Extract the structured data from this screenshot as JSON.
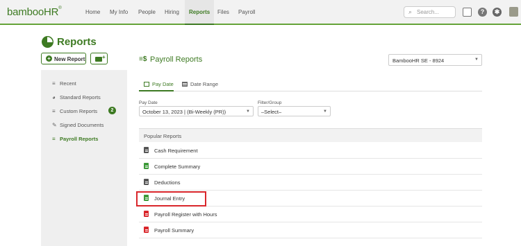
{
  "topnav": {
    "logo": "bambooHR",
    "items": [
      "Home",
      "My Info",
      "People",
      "Hiring",
      "Reports",
      "Files",
      "Payroll"
    ],
    "active_item": "Reports",
    "search_placeholder": "Search...",
    "icons": [
      "inbox-icon",
      "help-icon",
      "gear-icon",
      "avatar"
    ]
  },
  "page": {
    "title": "Reports",
    "new_report_label": "New Report"
  },
  "sidebar": {
    "items": [
      {
        "label": "Recent",
        "icon": "recent-icon"
      },
      {
        "label": "Standard Reports",
        "icon": "pie-chart-icon"
      },
      {
        "label": "Custom Reports",
        "icon": "custom-report-icon",
        "badge": "2"
      },
      {
        "label": "Signed Documents",
        "icon": "signature-icon"
      },
      {
        "label": "Payroll Reports",
        "icon": "payroll-icon",
        "active": true
      }
    ]
  },
  "main": {
    "title": "Payroll Reports",
    "company_select": "BambooHR SE - 8924",
    "tabs": [
      {
        "label": "Pay Date",
        "active": true
      },
      {
        "label": "Date Range",
        "active": false
      }
    ],
    "pay_date_label": "Pay Date",
    "pay_date_value": "October 13, 2023 | (Bi-Weekly (PR))",
    "filter_label": "Filter/Group",
    "filter_value": "–Select–",
    "panel_header": "Popular Reports",
    "reports": [
      {
        "label": "Cash Requirement",
        "icon_color": "#555555"
      },
      {
        "label": "Complete Summary",
        "icon_color": "#3d9a3a"
      },
      {
        "label": "Deductions",
        "icon_color": "#555555"
      },
      {
        "label": "Journal Entry",
        "icon_color": "#3d9a3a",
        "highlighted": true
      },
      {
        "label": "Payroll Register with Hours",
        "icon_color": "#d9262b"
      },
      {
        "label": "Payroll Summary",
        "icon_color": "#d9262b"
      }
    ]
  },
  "colors": {
    "brand_green": "#3d7a22",
    "highlight_red": "#d9262b"
  }
}
